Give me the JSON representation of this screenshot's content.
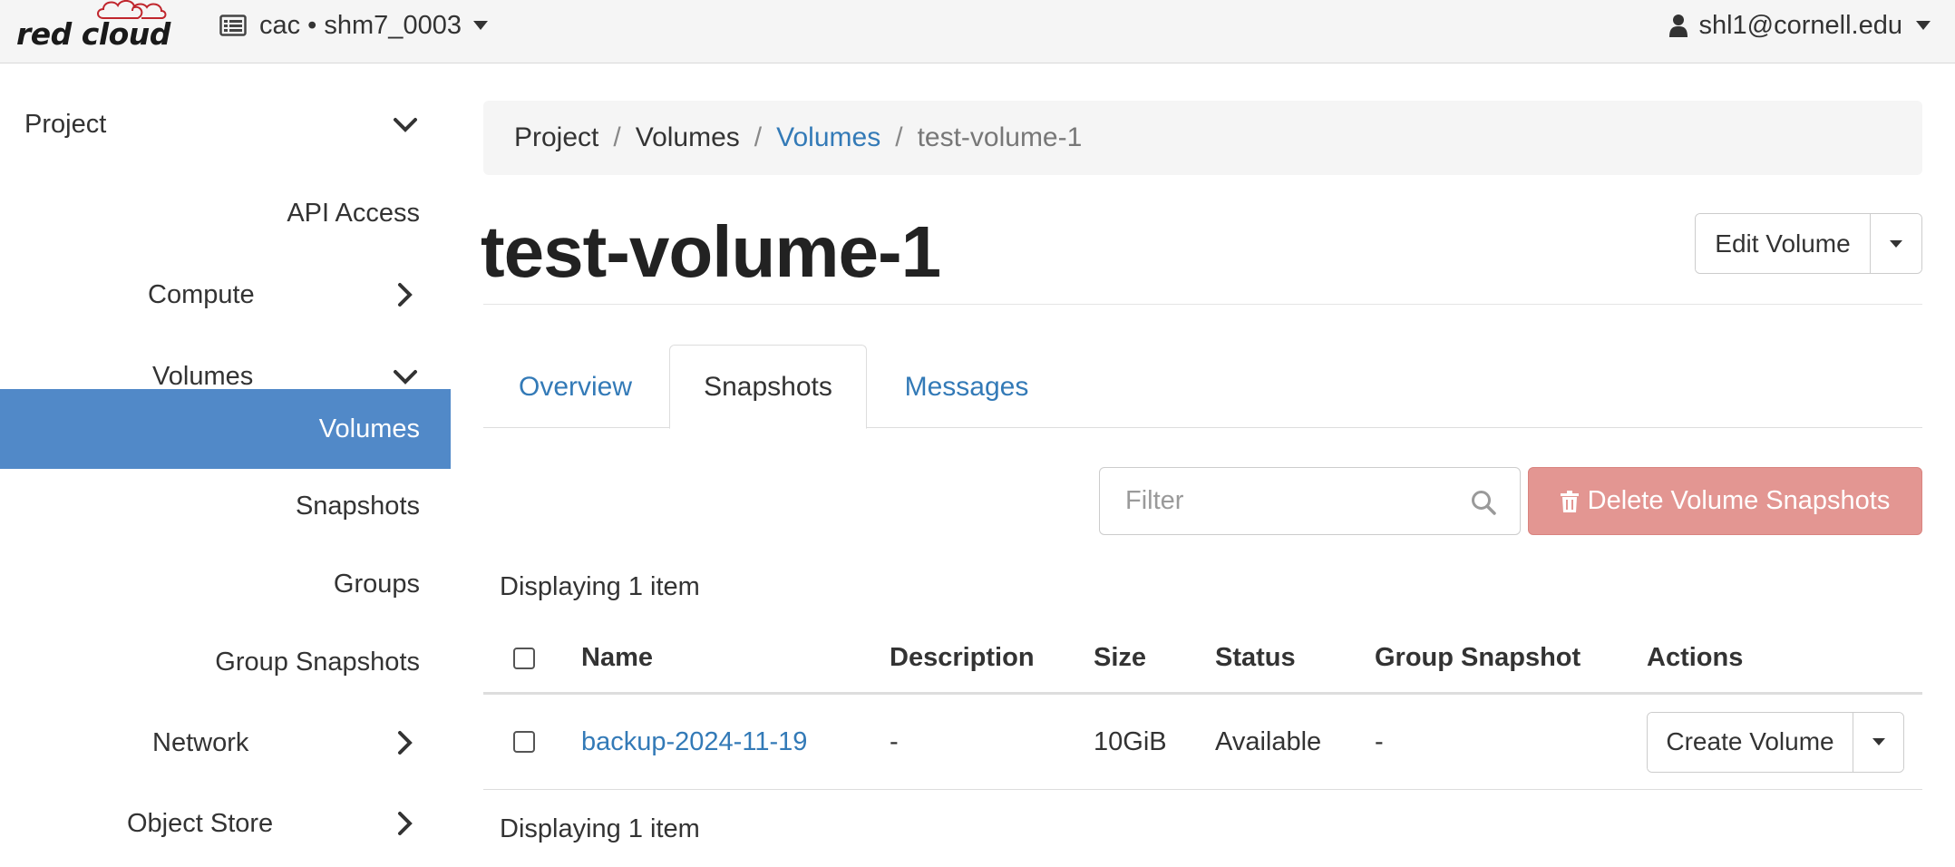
{
  "topbar": {
    "logo_text": "red cloud",
    "project_label": "cac • shm7_0003",
    "user_label": "shl1@cornell.edu"
  },
  "sidebar": {
    "project_label": "Project",
    "api_access": "API Access",
    "compute": "Compute",
    "volumes_group": "Volumes",
    "volumes_item": "Volumes",
    "snapshots_item": "Snapshots",
    "groups_item": "Groups",
    "group_snapshots_item": "Group Snapshots",
    "network": "Network",
    "object_store": "Object Store"
  },
  "breadcrumb": {
    "items": [
      "Project",
      "Volumes",
      "Volumes",
      "test-volume-1"
    ],
    "separator": "/"
  },
  "page": {
    "title": "test-volume-1",
    "edit_button": "Edit Volume"
  },
  "tabs": [
    "Overview",
    "Snapshots",
    "Messages"
  ],
  "toolbar": {
    "filter_placeholder": "Filter",
    "delete_button": "Delete Volume Snapshots"
  },
  "table": {
    "count_text": "Displaying 1 item",
    "columns": [
      "Name",
      "Description",
      "Size",
      "Status",
      "Group Snapshot",
      "Actions"
    ],
    "rows": [
      {
        "name": "backup-2024-11-19",
        "description": "-",
        "size": "10GiB",
        "status": "Available",
        "group_snapshot": "-",
        "action": "Create Volume"
      }
    ]
  },
  "colors": {
    "link": "#337ab7",
    "active_nav": "#5189c8",
    "danger_disabled": "#e39692",
    "brand_red": "#c0262d"
  }
}
